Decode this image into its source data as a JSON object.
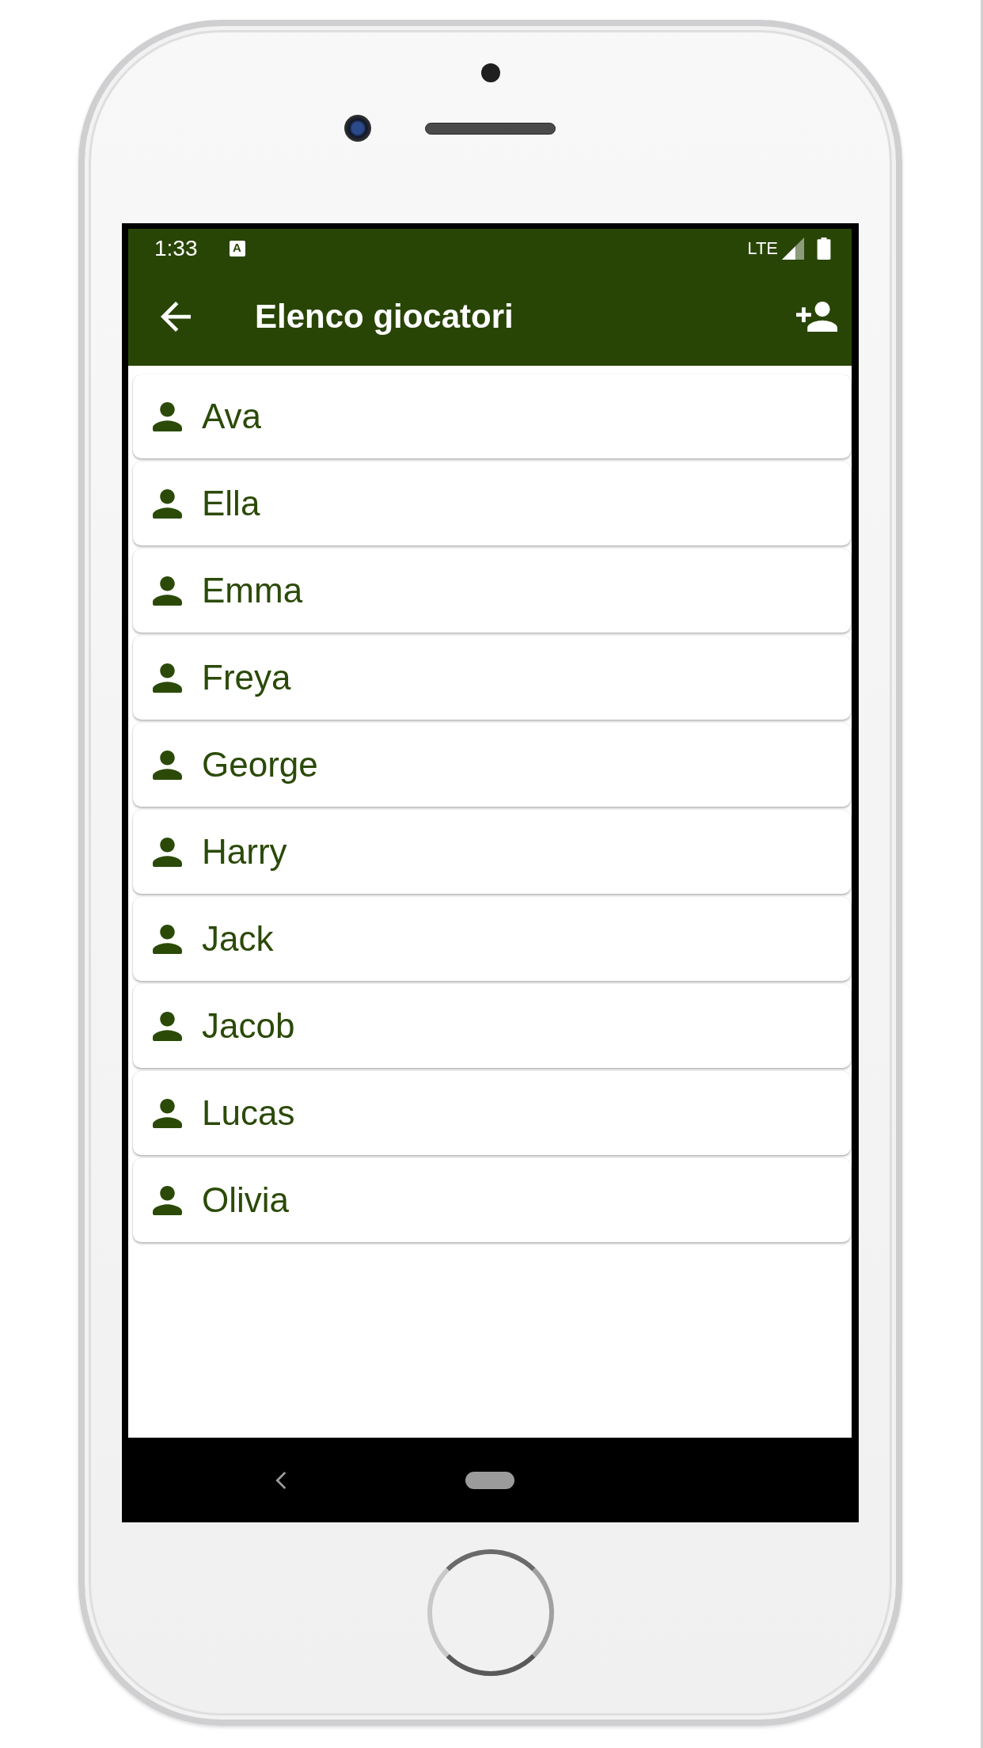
{
  "status_bar": {
    "time": "1:33",
    "notification": "A",
    "network": "LTE"
  },
  "app_bar": {
    "title": "Elenco giocatori"
  },
  "players": [
    {
      "name": "Ava"
    },
    {
      "name": "Ella"
    },
    {
      "name": "Emma"
    },
    {
      "name": "Freya"
    },
    {
      "name": "George"
    },
    {
      "name": "Harry"
    },
    {
      "name": "Jack"
    },
    {
      "name": "Jacob"
    },
    {
      "name": "Lucas"
    },
    {
      "name": "Olivia"
    }
  ]
}
